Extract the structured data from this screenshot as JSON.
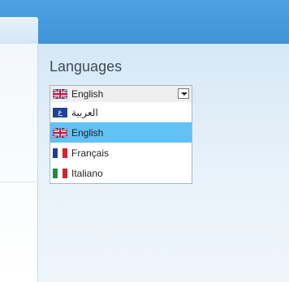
{
  "languages_widget": {
    "title": "Languages",
    "selected": {
      "label": "English",
      "flag_icon": "uk-flag-icon"
    },
    "options": [
      {
        "label": "العربية",
        "flag_icon": "arabic-flag-icon",
        "flag_glyph": "ع"
      },
      {
        "label": "English",
        "flag_icon": "uk-flag-icon",
        "highlighted": true
      },
      {
        "label": "Français",
        "flag_icon": "france-flag-icon"
      },
      {
        "label": "Italiano",
        "flag_icon": "italy-flag-icon"
      }
    ],
    "highlight_color": "#62c1f5"
  },
  "theme": {
    "header_color": "#4fa3e3",
    "panel_color": "#dbe9f6"
  }
}
